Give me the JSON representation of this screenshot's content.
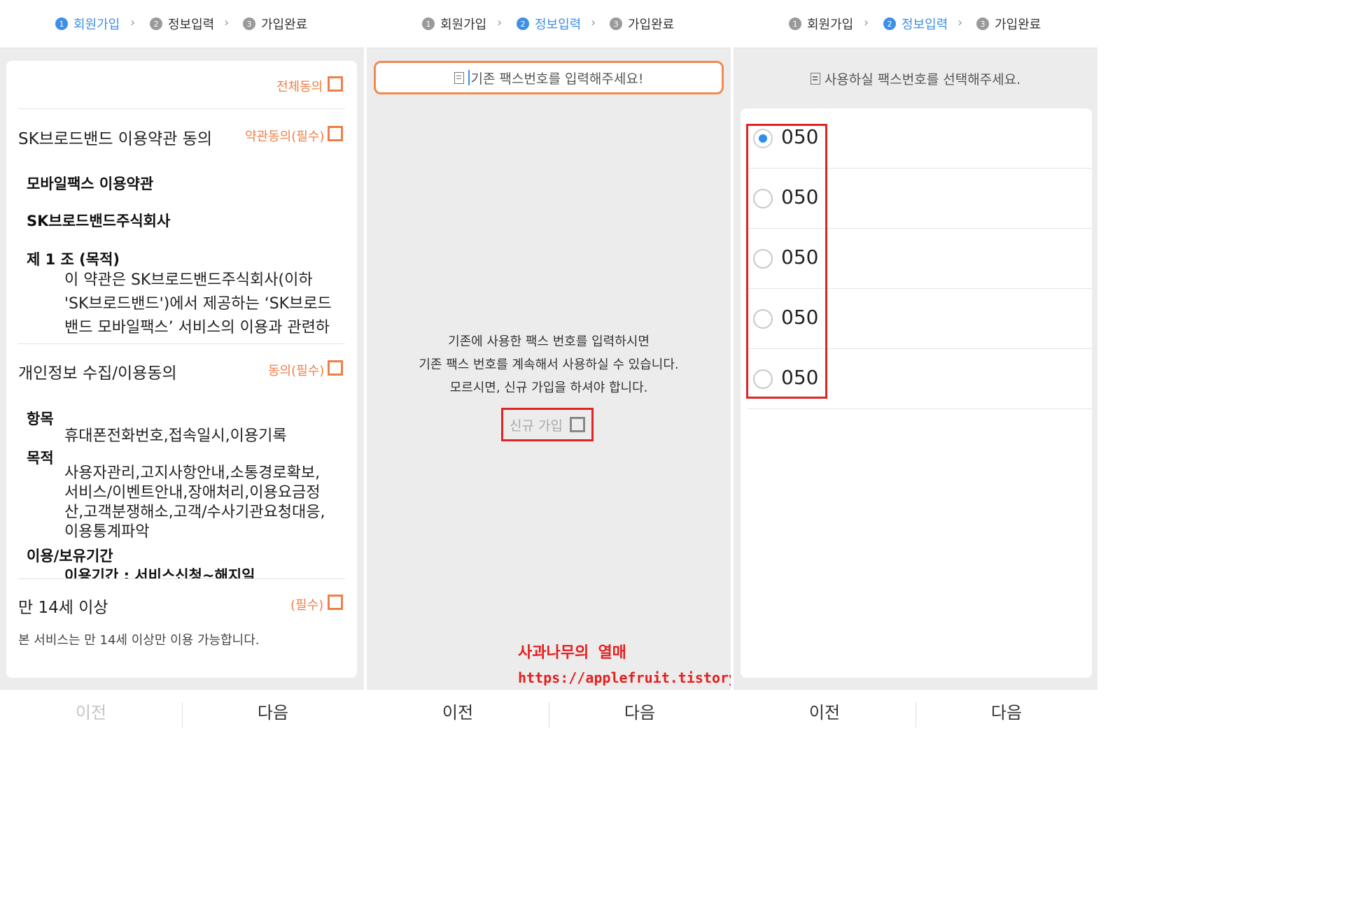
{
  "panels": [
    {
      "steps": [
        {
          "num": "1",
          "label": "회원가입"
        },
        {
          "num": "2",
          "label": "정보입력"
        },
        {
          "num": "3",
          "label": "가입완료"
        }
      ],
      "agree_all": "전체동의",
      "sections": {
        "sk_terms": {
          "title": "SK브로드밴드 이용약관 동의",
          "req": "약관동의(필수)",
          "terms_title": "모바일팩스 이용약관",
          "company": "SK브로드밴드주식회사",
          "article": "제 1 조 (목적)",
          "body": [
            "이 약관은 SK브로드밴드주식회사(이하",
            "'SK브로드밴드')에서 제공하는 ‘SK브로드",
            "밴드 모바일팩스’ 서비스의 이용과 관련하"
          ]
        },
        "privacy": {
          "title": "개인정보 수집/이용동의",
          "req": "동의(필수)",
          "item_h": "항목",
          "item_v": "휴대폰전화번호,접속일시,이용기록",
          "purpose_h": "목적",
          "purpose_v": [
            "사용자관리,고지사항안내,소통경로확보,",
            "서비스/이벤트안내,장애처리,이용요금정",
            "산,고객분쟁해소,고객/수사기관요청대응,",
            "이용통계파악"
          ],
          "period_h": "이용/보유기간",
          "period_v": "이용기간 : 서비스신청~해지일"
        },
        "age": {
          "title": "만 14세 이상",
          "req": "(필수)",
          "note": "본 서비스는 만 14세 이상만 이용 가능합니다."
        }
      },
      "footer": {
        "prev": "이전",
        "next": "다음"
      }
    },
    {
      "steps": [
        {
          "num": "1",
          "label": "회원가입"
        },
        {
          "num": "2",
          "label": "정보입력"
        },
        {
          "num": "3",
          "label": "가입완료"
        }
      ],
      "fax_placeholder": "기존 팩스번호를 입력해주세요!",
      "info_lines": [
        "기존에 사용한 팩스 번호를 입력하시면",
        "기존 팩스 번호를 계속해서 사용하실 수 있습니다.",
        "모르시면, 신규 가입을 하셔야 합니다."
      ],
      "new_join": "신규 가입",
      "watermark_title": "사과나무의 열매",
      "watermark_url": "https://applefruit.tistory.com",
      "footer": {
        "prev": "이전",
        "next": "다음"
      }
    },
    {
      "steps": [
        {
          "num": "1",
          "label": "회원가입"
        },
        {
          "num": "2",
          "label": "정보입력"
        },
        {
          "num": "3",
          "label": "가입완료"
        }
      ],
      "select_prompt": "사용하실 팩스번호를 선택해주세요.",
      "options": [
        "050",
        "050",
        "050",
        "050",
        "050"
      ],
      "footer": {
        "prev": "이전",
        "next": "다음"
      }
    }
  ],
  "colors": {
    "accent": "#3f8fe6",
    "orange": "#ef7f47",
    "highlight": "#e02424"
  },
  "icons": [
    "chevron-right-icon",
    "document-icon",
    "checkbox-icon",
    "radio-icon"
  ]
}
